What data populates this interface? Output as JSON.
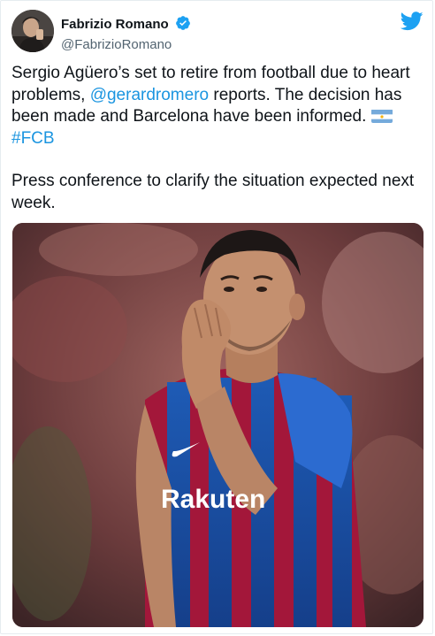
{
  "tweet": {
    "author": {
      "display_name": "Fabrizio Romano",
      "handle": "@FabrizioRomano",
      "verified": true,
      "avatar_icon": "profile-photo"
    },
    "platform_icon": "twitter-bird-icon",
    "text": {
      "line1_pre": "Sergio Agüero’s set to retire from football due to heart problems, ",
      "mention": "@gerardromero",
      "line1_post": " reports. The decision has been made and Barcelona have been informed. ",
      "flag_icon": "argentina-flag",
      "hashtag": "#FCB",
      "paragraph2": "Press conference to clarify the situation expected next week."
    },
    "media": {
      "type": "photo",
      "shirt_sponsor": "Rakuten"
    },
    "colors": {
      "link": "#1b95e0",
      "twitter_blue": "#1da1f2",
      "text": "#0f1419",
      "secondary": "#536471"
    }
  }
}
